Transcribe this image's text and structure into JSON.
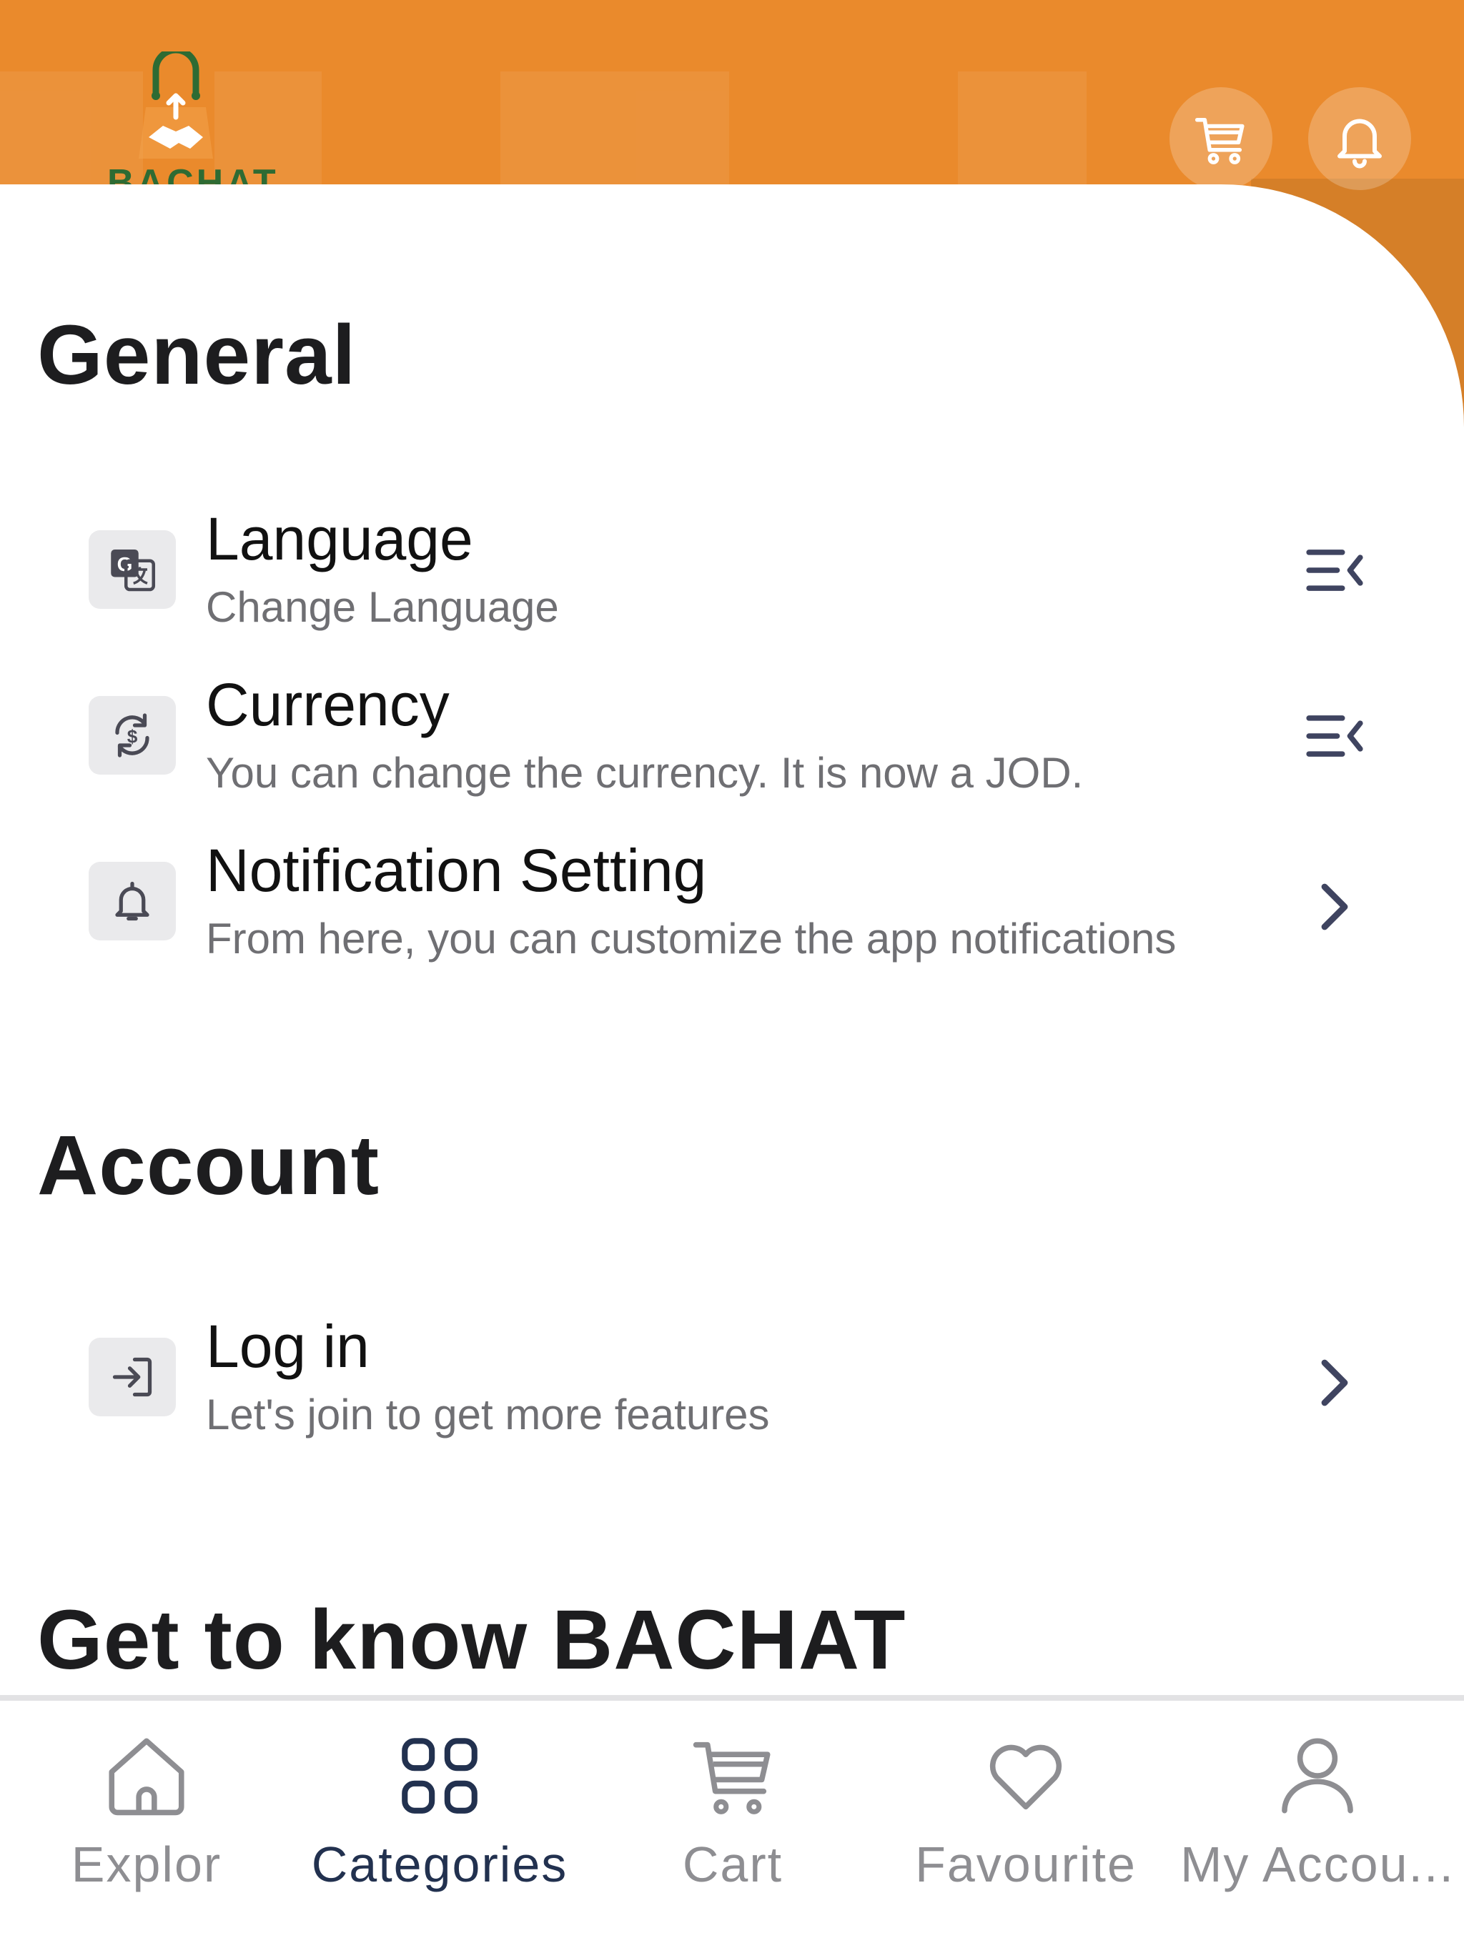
{
  "brand": {
    "name": "BACHAT",
    "accent_color": "#ea8a2c",
    "logo_green": "#2e6b33"
  },
  "header": {
    "cart_icon": "cart-icon",
    "notifications_icon": "bell-icon"
  },
  "sections": {
    "general": {
      "title": "General",
      "items": [
        {
          "title": "Language",
          "subtitle": "Change Language",
          "icon": "translate-icon",
          "trailing_icon": "menu-collapse-icon"
        },
        {
          "title": "Currency",
          "subtitle": "You can change the currency. It is now a JOD.",
          "icon": "currency-exchange-icon",
          "trailing_icon": "menu-collapse-icon"
        },
        {
          "title": "Notification Setting",
          "subtitle": "From here, you can customize the app notifications",
          "icon": "bell-icon",
          "trailing_icon": "chevron-right-icon"
        }
      ]
    },
    "account": {
      "title": "Account",
      "items": [
        {
          "title": "Log in",
          "subtitle": "Let's join to get more features",
          "icon": "login-icon",
          "trailing_icon": "chevron-right-icon"
        }
      ]
    },
    "about": {
      "title": "Get to know BACHAT"
    }
  },
  "bottom_nav": {
    "active_color": "#22314f",
    "inactive_color": "#8e8e92",
    "items": [
      {
        "label": "Explor",
        "icon": "home-icon",
        "active": false
      },
      {
        "label": "Categories",
        "icon": "grid-icon",
        "active": true
      },
      {
        "label": "Cart",
        "icon": "cart-icon",
        "active": false
      },
      {
        "label": "Favourite",
        "icon": "heart-icon",
        "active": false
      },
      {
        "label": "My Accou...",
        "icon": "user-icon",
        "active": false
      }
    ]
  }
}
